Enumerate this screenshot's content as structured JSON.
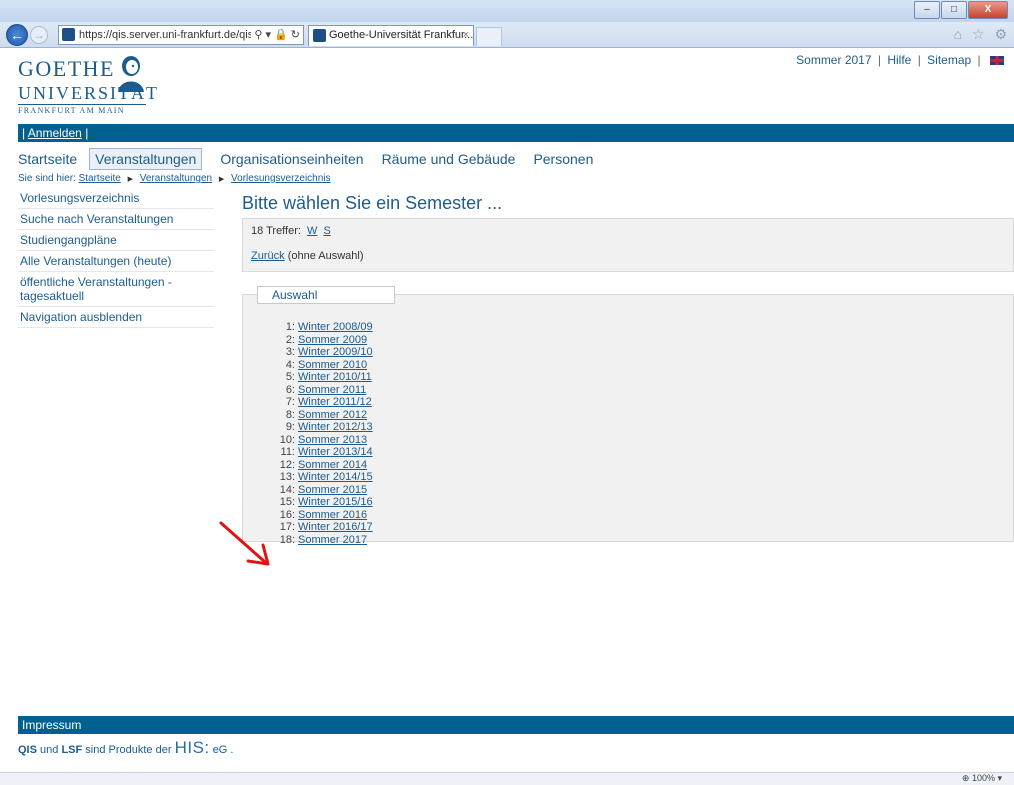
{
  "browser": {
    "url": "https://qis.server.uni-frankfurt.de/qisser",
    "addr_icons": "⚲ ▾ 🔒 ↻",
    "tab_title": "Goethe-Universität Frankfur...",
    "tab_close": "×",
    "min": "–",
    "max": "□",
    "close": "X",
    "toolbar_icons": "⌂ ☆ ⚙",
    "zoom": "⊕ 100%  ▾"
  },
  "logo": {
    "line1": "GOETHE",
    "line2": "UNIVERSITÄT",
    "line3": "FRANKFURT AM MAIN"
  },
  "toplinks": {
    "semester": "Sommer 2017",
    "hilfe": "Hilfe",
    "sitemap": "Sitemap",
    "sep": "|"
  },
  "loginbar": {
    "login": "Anmelden",
    "sep": "|"
  },
  "mainnav": [
    "Startseite",
    "Veranstaltungen",
    "Organisationseinheiten",
    "Räume und Gebäude",
    "Personen"
  ],
  "breadcrumb": {
    "prefix": "Sie sind hier:",
    "items": [
      "Startseite",
      "Veranstaltungen",
      "Vorlesungsverzeichnis"
    ]
  },
  "sidenav": [
    "Vorlesungsverzeichnis",
    "Suche nach Veranstaltungen",
    "Studiengangpläne",
    "Alle Veranstaltungen (heute)",
    "öffentliche Veranstaltungen - tagesaktuell",
    "Navigation ausblenden"
  ],
  "content": {
    "title": "Bitte wählen Sie ein Semester ...",
    "hits": "18 Treffer:",
    "filter_w": "W",
    "filter_s": "S",
    "back_link": "Zurück",
    "back_note": "(ohne Auswahl)",
    "legend": "Auswahl",
    "semesters": [
      {
        "num": "1:",
        "name": "Winter 2008/09"
      },
      {
        "num": "2:",
        "name": "Sommer 2009"
      },
      {
        "num": "3:",
        "name": "Winter 2009/10"
      },
      {
        "num": "4:",
        "name": "Sommer 2010"
      },
      {
        "num": "5:",
        "name": "Winter 2010/11"
      },
      {
        "num": "6:",
        "name": "Sommer 2011"
      },
      {
        "num": "7:",
        "name": "Winter 2011/12"
      },
      {
        "num": "8:",
        "name": "Sommer 2012"
      },
      {
        "num": "9:",
        "name": "Winter 2012/13"
      },
      {
        "num": "10:",
        "name": "Sommer 2013"
      },
      {
        "num": "11:",
        "name": "Winter 2013/14"
      },
      {
        "num": "12:",
        "name": "Sommer 2014"
      },
      {
        "num": "13:",
        "name": "Winter 2014/15"
      },
      {
        "num": "14:",
        "name": "Sommer 2015"
      },
      {
        "num": "15:",
        "name": "Winter 2015/16"
      },
      {
        "num": "16:",
        "name": "Sommer 2016"
      },
      {
        "num": "17:",
        "name": "Winter 2016/17"
      },
      {
        "num": "18:",
        "name": "Sommer 2017"
      }
    ]
  },
  "footer": {
    "impressum": "Impressum",
    "qis": "QIS",
    "und": "und",
    "lsf": "LSF",
    "rest": "sind Produkte der",
    "his": "HIS:",
    "eg": "eG ."
  },
  "colors": {
    "brand": "#00618f",
    "link": "#1d5c8e",
    "annotation_arrow": "#e01414"
  }
}
